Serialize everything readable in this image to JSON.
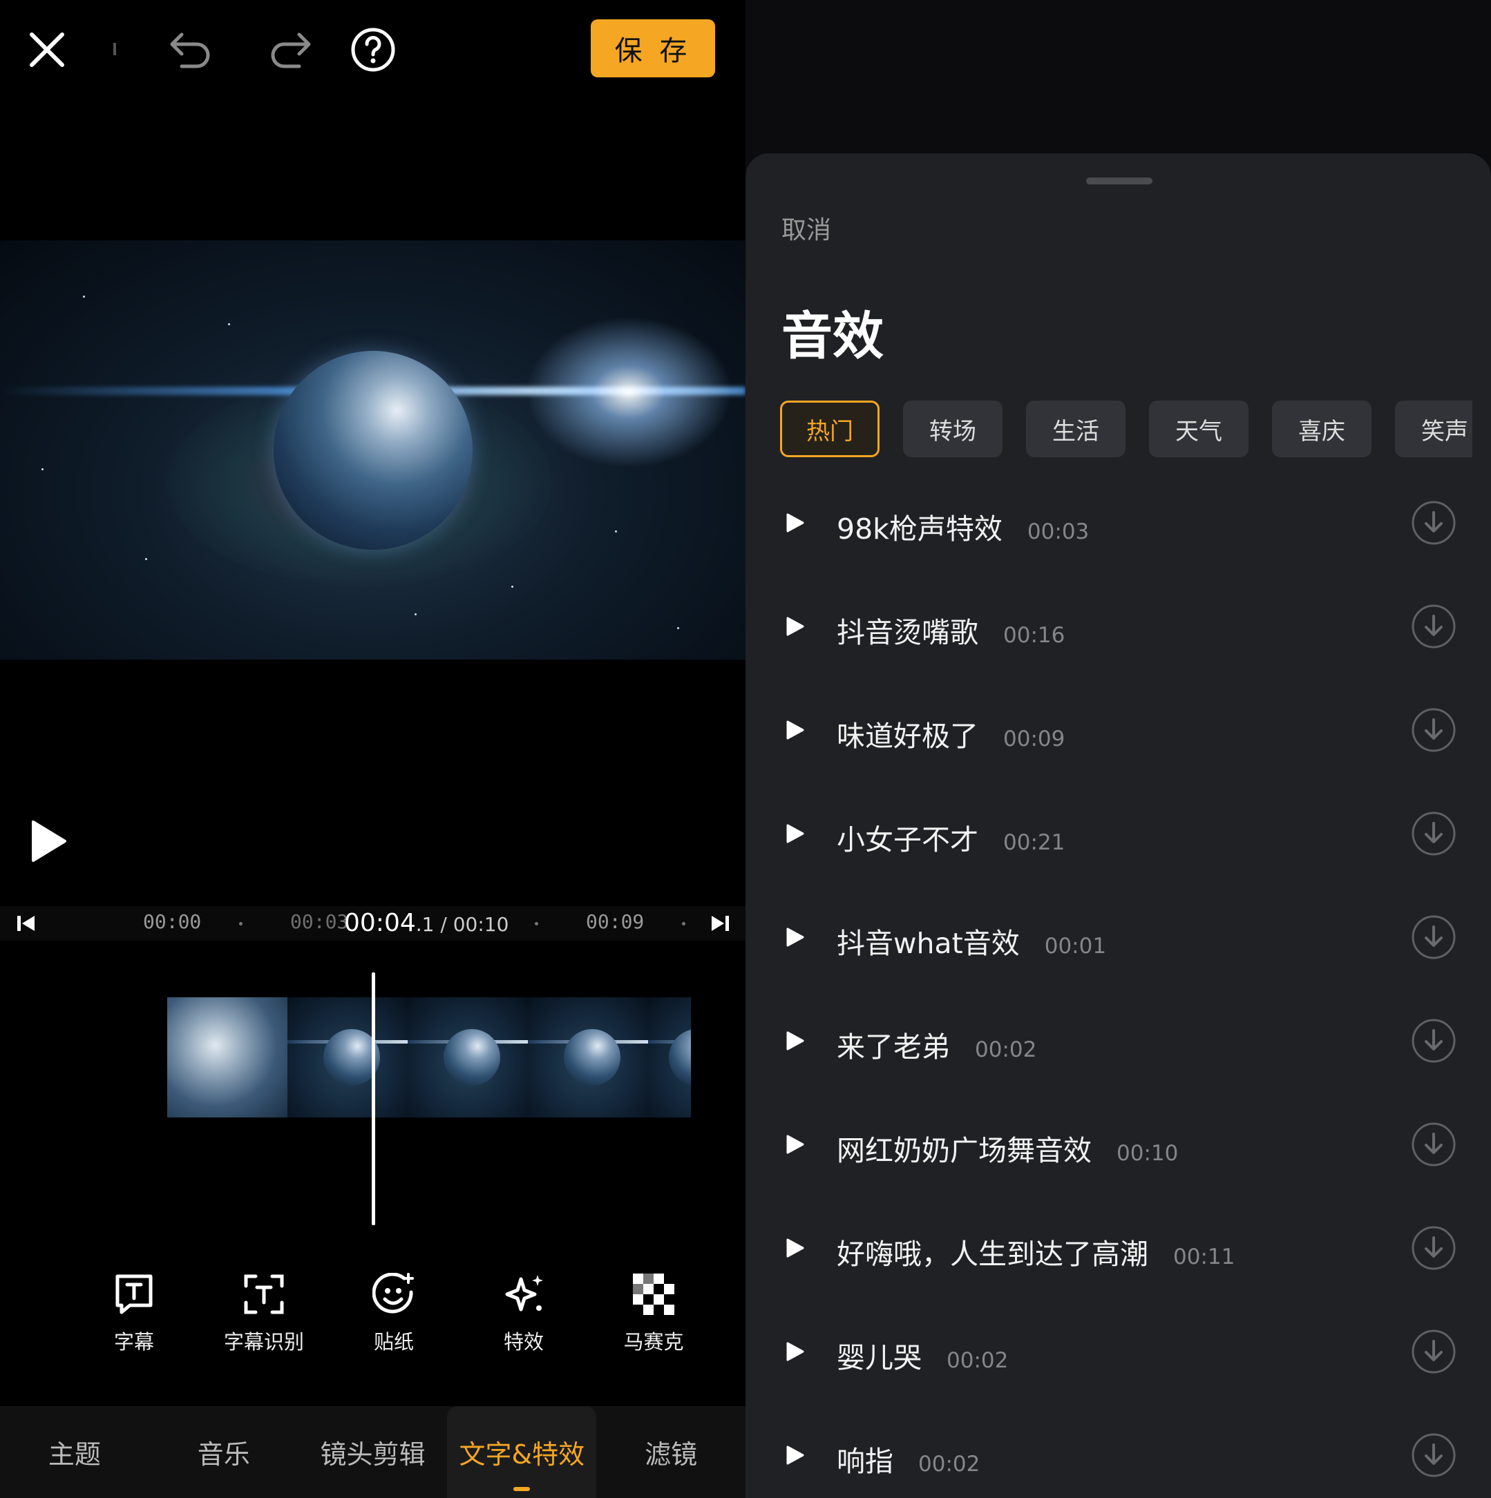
{
  "toolbar": {
    "save_label": "保 存",
    "icons": [
      "close-icon",
      "undo-icon",
      "redo-icon",
      "help-icon"
    ]
  },
  "timeline": {
    "ticks": [
      "00:00",
      "00:03",
      "00:09"
    ],
    "current_main": "00:04",
    "current_tenth": ".1",
    "total": " / 00:10"
  },
  "tools": [
    {
      "label": "字幕",
      "icon": "subtitle-icon"
    },
    {
      "label": "字幕识别",
      "icon": "subtitle-recognition-icon"
    },
    {
      "label": "贴纸",
      "icon": "sticker-icon"
    },
    {
      "label": "特效",
      "icon": "effects-sparkle-icon"
    },
    {
      "label": "马赛克",
      "icon": "mosaic-icon"
    }
  ],
  "bottom_nav": [
    {
      "label": "主题"
    },
    {
      "label": "音乐"
    },
    {
      "label": "镜头剪辑"
    },
    {
      "label": "文字&特效",
      "active": true
    },
    {
      "label": "滤镜"
    }
  ],
  "sheet": {
    "cancel_label": "取消",
    "title": "音效",
    "chips": [
      "热门",
      "转场",
      "生活",
      "天气",
      "喜庆",
      "笑声"
    ],
    "active_chip": "热门",
    "sounds": [
      {
        "name": "98k枪声特效",
        "duration": "00:03"
      },
      {
        "name": "抖音烫嘴歌",
        "duration": "00:16"
      },
      {
        "name": "味道好极了",
        "duration": "00:09"
      },
      {
        "name": "小女子不才",
        "duration": "00:21"
      },
      {
        "name": "抖音what音效",
        "duration": "00:01"
      },
      {
        "name": "来了老弟",
        "duration": "00:02"
      },
      {
        "name": "网红奶奶广场舞音效",
        "duration": "00:10"
      },
      {
        "name": "好嗨哦，人生到达了高潮",
        "duration": "00:11"
      },
      {
        "name": "婴儿哭",
        "duration": "00:02"
      },
      {
        "name": "响指",
        "duration": "00:02"
      }
    ]
  },
  "colors": {
    "accent": "#f5a623",
    "sheet_bg": "#202124",
    "editor_bg": "#000000"
  }
}
